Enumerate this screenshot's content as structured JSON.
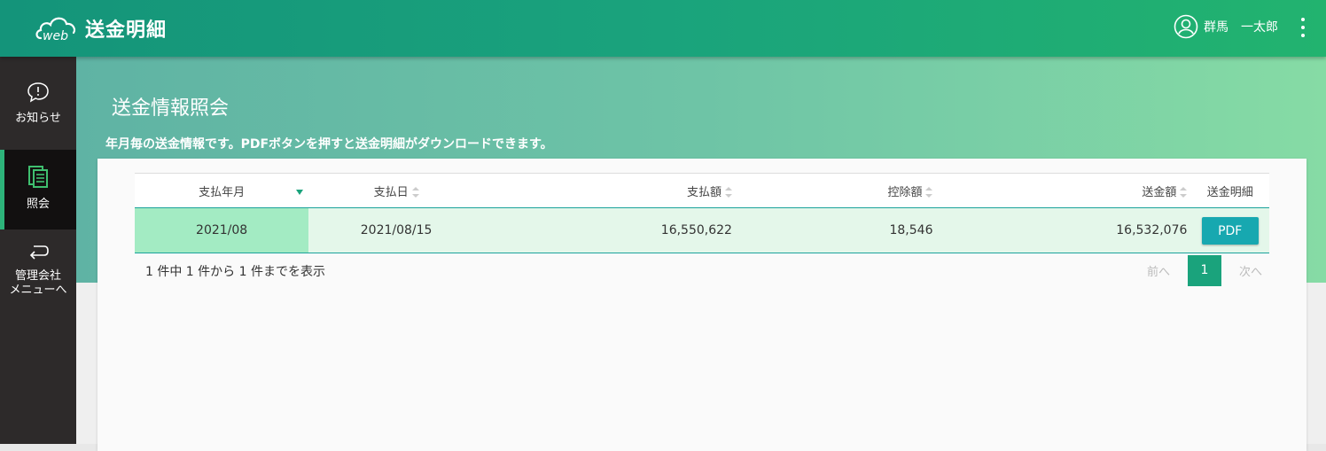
{
  "header": {
    "logo_text": "送金明細",
    "logo_prefix": "web",
    "user_name": "群馬　一太郎"
  },
  "sidebar": {
    "items": [
      {
        "label": "お知らせ",
        "icon": "speech-bubble-icon"
      },
      {
        "label": "照会",
        "icon": "document-icon",
        "active": true
      },
      {
        "label_line1": "管理会社",
        "label_line2": "メニューへ",
        "icon": "return-arrow-icon"
      }
    ]
  },
  "main": {
    "title": "送金情報照会",
    "description": "年月毎の送金情報です。PDFボタンを押すと送金明細がダウンロードできます。"
  },
  "table": {
    "columns": [
      "支払年月",
      "支払日",
      "支払額",
      "控除額",
      "送金額",
      "送金明細"
    ],
    "rows": [
      {
        "month": "2021/08",
        "date": "2021/08/15",
        "paid": "16,550,622",
        "deduction": "18,546",
        "remit": "16,532,076",
        "button": "PDF"
      }
    ]
  },
  "footer": {
    "info": "1 件中 1 件から 1 件までを表示",
    "prev": "前へ",
    "page": "1",
    "next": "次へ"
  },
  "colors": {
    "accent": "#1aa37c",
    "pdf_button": "#17a8b0",
    "sidebar_bg": "#2d2a2a"
  }
}
